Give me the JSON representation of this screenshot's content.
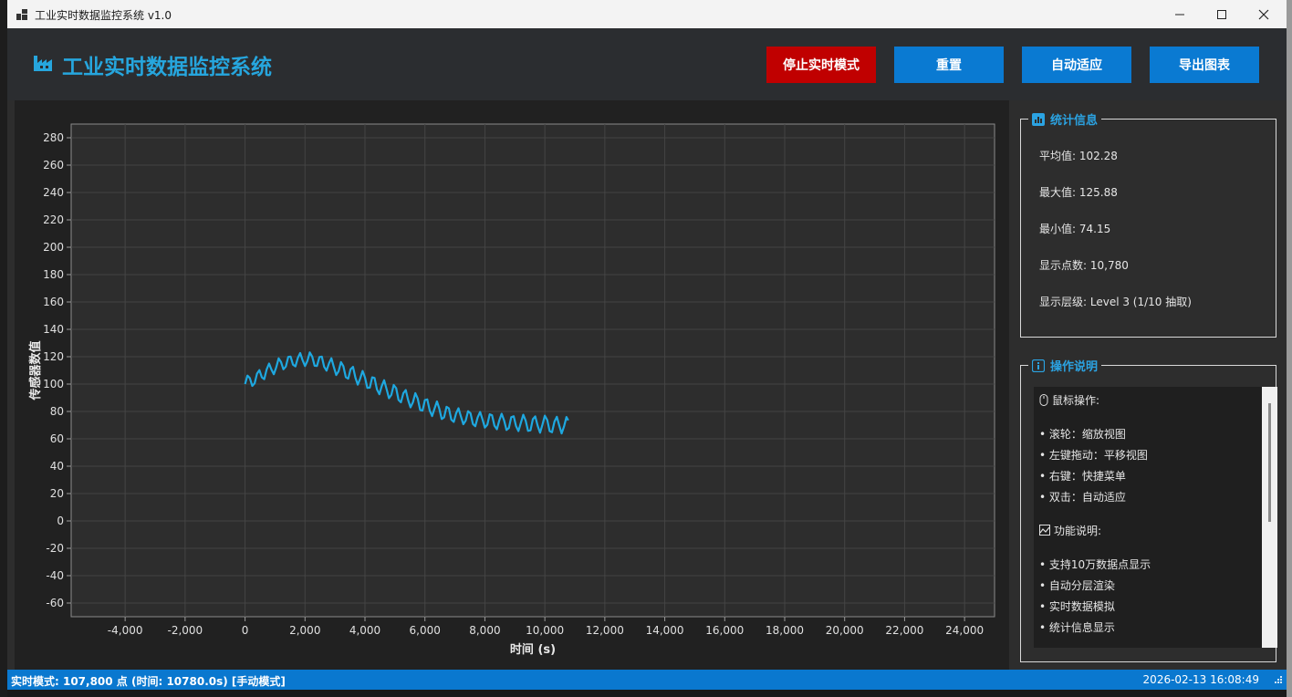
{
  "window": {
    "title": "工业实时数据监控系统 v1.0",
    "controls": {
      "minimize": "—",
      "maximize": "☐",
      "close": "✕"
    }
  },
  "header": {
    "title": "工业实时数据监控系统",
    "buttons": {
      "stop_realtime": "停止实时模式",
      "reset": "重置",
      "auto_fit": "自动适应",
      "export": "导出图表"
    }
  },
  "chart_data": {
    "type": "line",
    "xlabel": "时间 (s)",
    "ylabel": "传感器数值",
    "xlim": [
      -5800,
      25000
    ],
    "ylim": [
      -70,
      290
    ],
    "x_ticks": [
      -4000,
      -2000,
      0,
      2000,
      4000,
      6000,
      8000,
      10000,
      12000,
      14000,
      16000,
      18000,
      20000,
      22000,
      24000
    ],
    "x_tick_labels": [
      "-4,000",
      "-2,000",
      "0",
      "2,000",
      "4,000",
      "6,000",
      "8,000",
      "10,000",
      "12,000",
      "14,000",
      "16,000",
      "18,000",
      "20,000",
      "22,000",
      "24,000"
    ],
    "y_ticks": [
      -60,
      -40,
      -20,
      0,
      20,
      40,
      60,
      80,
      100,
      120,
      140,
      160,
      180,
      200,
      220,
      240,
      260,
      280
    ],
    "y_tick_labels": [
      "-60",
      "-40",
      "-20",
      "0",
      "20",
      "40",
      "60",
      "80",
      "100",
      "120",
      "140",
      "160",
      "180",
      "200",
      "220",
      "240",
      "260",
      "280"
    ],
    "grid": true,
    "series": [
      {
        "color": "#1ea8e0",
        "x": [
          0,
          80,
          160,
          240,
          320,
          400,
          480,
          560,
          640,
          720,
          800,
          880,
          960,
          1040,
          1120,
          1200,
          1280,
          1360,
          1440,
          1520,
          1600,
          1680,
          1760,
          1840,
          1920,
          2000,
          2080,
          2160,
          2240,
          2320,
          2400,
          2480,
          2560,
          2640,
          2720,
          2800,
          2880,
          2960,
          3040,
          3120,
          3200,
          3280,
          3360,
          3440,
          3520,
          3600,
          3680,
          3760,
          3840,
          3920,
          4000,
          4080,
          4160,
          4240,
          4320,
          4400,
          4480,
          4560,
          4640,
          4720,
          4800,
          4880,
          4960,
          5040,
          5120,
          5200,
          5280,
          5360,
          5440,
          5520,
          5600,
          5680,
          5760,
          5840,
          5920,
          6000,
          6080,
          6160,
          6240,
          6320,
          6400,
          6480,
          6560,
          6640,
          6720,
          6800,
          6880,
          6960,
          7040,
          7120,
          7200,
          7280,
          7360,
          7440,
          7520,
          7600,
          7680,
          7760,
          7840,
          7920,
          8000,
          8080,
          8160,
          8240,
          8320,
          8400,
          8480,
          8560,
          8640,
          8720,
          8800,
          8880,
          8960,
          9040,
          9120,
          9200,
          9280,
          9360,
          9440,
          9520,
          9600,
          9680,
          9760,
          9840,
          9920,
          10000,
          10080,
          10160,
          10240,
          10320,
          10400,
          10480,
          10560,
          10640,
          10720,
          10780
        ],
        "y": [
          100,
          106.2,
          104.4,
          98.7,
          100.6,
          107.7,
          110.2,
          104.9,
          103.6,
          110.6,
          115,
          110.6,
          107.2,
          112.1,
          118.8,
          116.1,
          110.8,
          112.8,
          119.9,
          120.1,
          114.2,
          112.9,
          119.1,
          122.7,
          117.3,
          113.2,
          116.9,
          123.1,
          120.1,
          113.4,
          113.3,
          119.8,
          120.1,
          112.6,
          109.8,
          115.2,
          118.9,
          112.6,
          106.6,
          109.4,
          116.1,
          113.1,
          105,
          103.9,
          110.8,
          112.6,
          104.7,
          99.6,
          103.9,
          109.6,
          104.8,
          97.2,
          97.4,
          104.9,
          104.5,
          96.2,
          92.6,
          98.6,
          102.8,
          96.3,
          89.7,
          92.1,
          99.3,
          97,
          88.4,
          86.7,
          93.4,
          95.7,
          88.3,
          83,
          86.8,
          93.4,
          89.5,
          81.1,
          80.7,
          88.3,
          88.8,
          80.6,
          76.6,
          82,
          87.3,
          81.9,
          74.5,
          75.7,
          83.4,
          82.2,
          74.1,
          72.3,
          78.7,
          82.3,
          76.5,
          70.7,
          73.3,
          80.2,
          78.6,
          70.8,
          69.2,
          75.6,
          79.6,
          74.2,
          68.2,
          70.3,
          77.9,
          77.2,
          69.6,
          67,
          73.4,
          78.3,
          73.4,
          66.5,
          67.9,
          75.8,
          76.5,
          69.2,
          65.7,
          71.8,
          77.6,
          73.3,
          65.8,
          66.2,
          74.3,
          76.4,
          69.4,
          64.5,
          70.3,
          76.9,
          73.7,
          65.7,
          64.8,
          72.6,
          76.1,
          69.8,
          63.9,
          69.1,
          75.9,
          73.5
        ]
      }
    ]
  },
  "stats": {
    "title": "统计信息",
    "mean": "平均值: 102.28",
    "max": "最大值: 125.88",
    "min": "最小值: 74.15",
    "points": "显示点数: 10,780",
    "level": "显示层级: Level 3 (1/10 抽取)"
  },
  "help": {
    "title": "操作说明",
    "mouse_header": "鼠标操作:",
    "mouse_items": [
      "• 滚轮：缩放视图",
      "• 左键拖动：平移视图",
      "• 右键：快捷菜单",
      "• 双击：自动适应"
    ],
    "feature_header": "功能说明:",
    "feature_items": [
      "• 支持10万数据点显示",
      "• 自动分层渲染",
      "• 实时数据模拟",
      "• 统计信息显示"
    ]
  },
  "status": {
    "left": "实时模式: 107,800 点 (时间: 10780.0s) [手动模式]",
    "right": "2026-02-13 16:08:49"
  }
}
